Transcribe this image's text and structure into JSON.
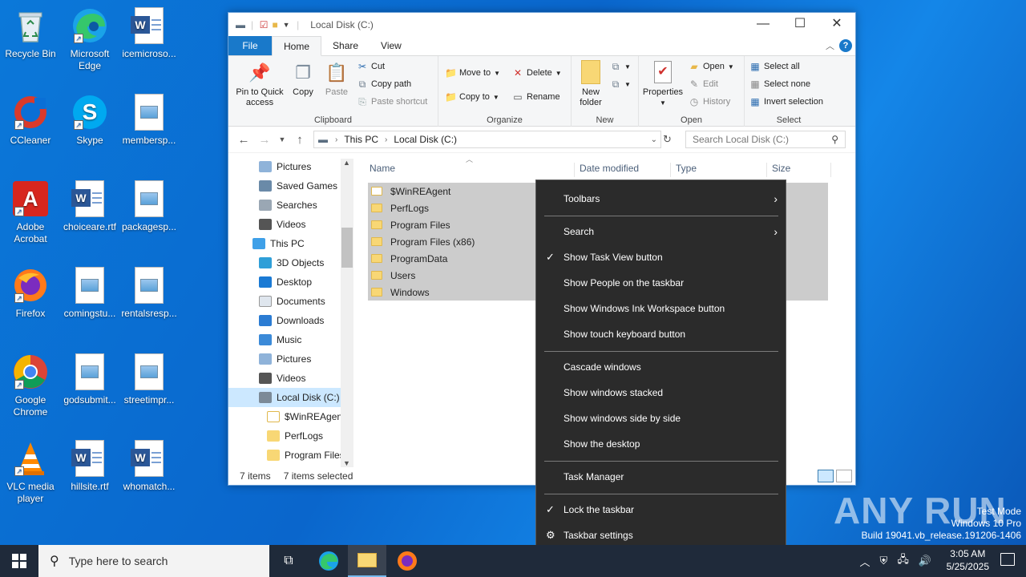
{
  "desktop_icons": [
    {
      "label": "Recycle Bin"
    },
    {
      "label": "Microsoft Edge"
    },
    {
      "label": "icemicroso..."
    },
    {
      "label": "CCleaner"
    },
    {
      "label": "Skype"
    },
    {
      "label": "membersp..."
    },
    {
      "label": "Adobe Acrobat"
    },
    {
      "label": "choiceare.rtf"
    },
    {
      "label": "packagesp..."
    },
    {
      "label": "Firefox"
    },
    {
      "label": "comingstu..."
    },
    {
      "label": "rentalsresp..."
    },
    {
      "label": "Google Chrome"
    },
    {
      "label": "godsubmit..."
    },
    {
      "label": "streetimpr..."
    },
    {
      "label": "VLC media player"
    },
    {
      "label": "hillsite.rtf"
    },
    {
      "label": "whomatch..."
    }
  ],
  "explorer": {
    "title": "Local Disk (C:)",
    "tabs": [
      "File",
      "Home",
      "Share",
      "View"
    ],
    "ribbon": {
      "clipboard": {
        "label": "Clipboard",
        "pin": "Pin to Quick access",
        "copy": "Copy",
        "paste": "Paste",
        "cut": "Cut",
        "copy_path": "Copy path",
        "paste_shortcut": "Paste shortcut"
      },
      "organize": {
        "label": "Organize",
        "move_to": "Move to",
        "copy_to": "Copy to",
        "delete": "Delete",
        "rename": "Rename"
      },
      "new": {
        "label": "New",
        "new_folder": "New folder"
      },
      "open": {
        "label": "Open",
        "properties": "Properties",
        "open": "Open",
        "edit": "Edit",
        "history": "History"
      },
      "select": {
        "label": "Select",
        "select_all": "Select all",
        "select_none": "Select none",
        "invert": "Invert selection"
      }
    },
    "address": {
      "this_pc": "This PC",
      "location": "Local Disk (C:)"
    },
    "search_placeholder": "Search Local Disk (C:)",
    "nav_items": [
      "Pictures",
      "Saved Games",
      "Searches",
      "Videos",
      "This PC",
      "3D Objects",
      "Desktop",
      "Documents",
      "Downloads",
      "Music",
      "Pictures",
      "Videos",
      "Local Disk (C:)",
      "$WinREAgent",
      "PerfLogs",
      "Program Files"
    ],
    "columns": [
      "Name",
      "Date modified",
      "Type",
      "Size"
    ],
    "files": [
      "$WinREAgent",
      "PerfLogs",
      "Program Files",
      "Program Files (x86)",
      "ProgramData",
      "Users",
      "Windows"
    ],
    "status": {
      "items": "7 items",
      "selected": "7 items selected"
    }
  },
  "context_menu": {
    "toolbars": "Toolbars",
    "search": "Search",
    "task_view": "Show Task View button",
    "people": "Show People on the taskbar",
    "ink": "Show Windows Ink Workspace button",
    "touch_kb": "Show touch keyboard button",
    "cascade": "Cascade windows",
    "stacked": "Show windows stacked",
    "side_by_side": "Show windows side by side",
    "show_desktop": "Show the desktop",
    "task_manager": "Task Manager",
    "lock": "Lock the taskbar",
    "settings": "Taskbar settings"
  },
  "taskbar": {
    "search_placeholder": "Type here to search",
    "time": "3:05 AM",
    "date": "5/25/2025"
  },
  "watermark": {
    "brand": "ANY RUN",
    "mode": "Test Mode",
    "edition": "Windows 10 Pro",
    "build": "Build 19041.vb_release.191206-1406"
  }
}
